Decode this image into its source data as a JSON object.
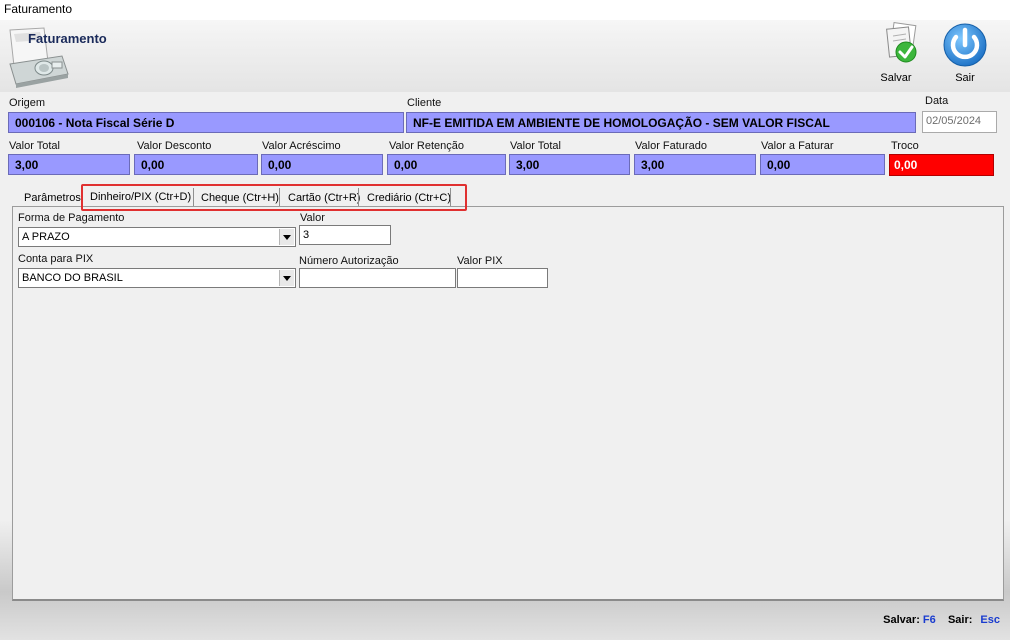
{
  "window": {
    "title": "Faturamento"
  },
  "header": {
    "title": "Faturamento"
  },
  "toolbar": {
    "save_label": "Salvar",
    "exit_label": "Sair"
  },
  "origem": {
    "label": "Origem",
    "value": "000106 - Nota Fiscal Série D"
  },
  "cliente": {
    "label": "Cliente",
    "value": "NF-E EMITIDA EM AMBIENTE DE HOMOLOGAÇÃO - SEM VALOR FISCAL"
  },
  "data": {
    "label": "Data",
    "value": "02/05/2024"
  },
  "totals": [
    {
      "label": "Valor Total",
      "value": "3,00"
    },
    {
      "label": "Valor Desconto",
      "value": "0,00"
    },
    {
      "label": "Valor Acréscimo",
      "value": "0,00"
    },
    {
      "label": "Valor Retenção",
      "value": "0,00"
    },
    {
      "label": "Valor Total",
      "value": "3,00"
    },
    {
      "label": "Valor Faturado",
      "value": "3,00"
    },
    {
      "label": "Valor a Faturar",
      "value": "0,00"
    },
    {
      "label": "Troco",
      "value": "0,00"
    }
  ],
  "tabs": [
    {
      "label": "Parâmetros"
    },
    {
      "label": "Dinheiro/PIX (Ctr+D)"
    },
    {
      "label": "Cheque (Ctr+H)"
    },
    {
      "label": "Cartão (Ctr+R)"
    },
    {
      "label": "Crediário (Ctr+C)"
    }
  ],
  "form": {
    "forma_pagamento": {
      "label": "Forma de Pagamento",
      "value": "A PRAZO"
    },
    "valor": {
      "label": "Valor",
      "value": "3"
    },
    "conta_pix": {
      "label": "Conta para PIX",
      "value": "BANCO DO BRASIL"
    },
    "numero_autorizacao": {
      "label": "Número Autorização",
      "value": ""
    },
    "valor_pix": {
      "label": "Valor PIX",
      "value": ""
    }
  },
  "footer": {
    "save_label": "Salvar:",
    "save_key": "F6",
    "exit_label": "Sair:",
    "exit_key": "Esc"
  },
  "colors": {
    "field_blue": "#9999ff",
    "troco_red": "#ff0000",
    "highlight_red": "#e03030",
    "shortcut_blue": "#1a3ccf"
  }
}
